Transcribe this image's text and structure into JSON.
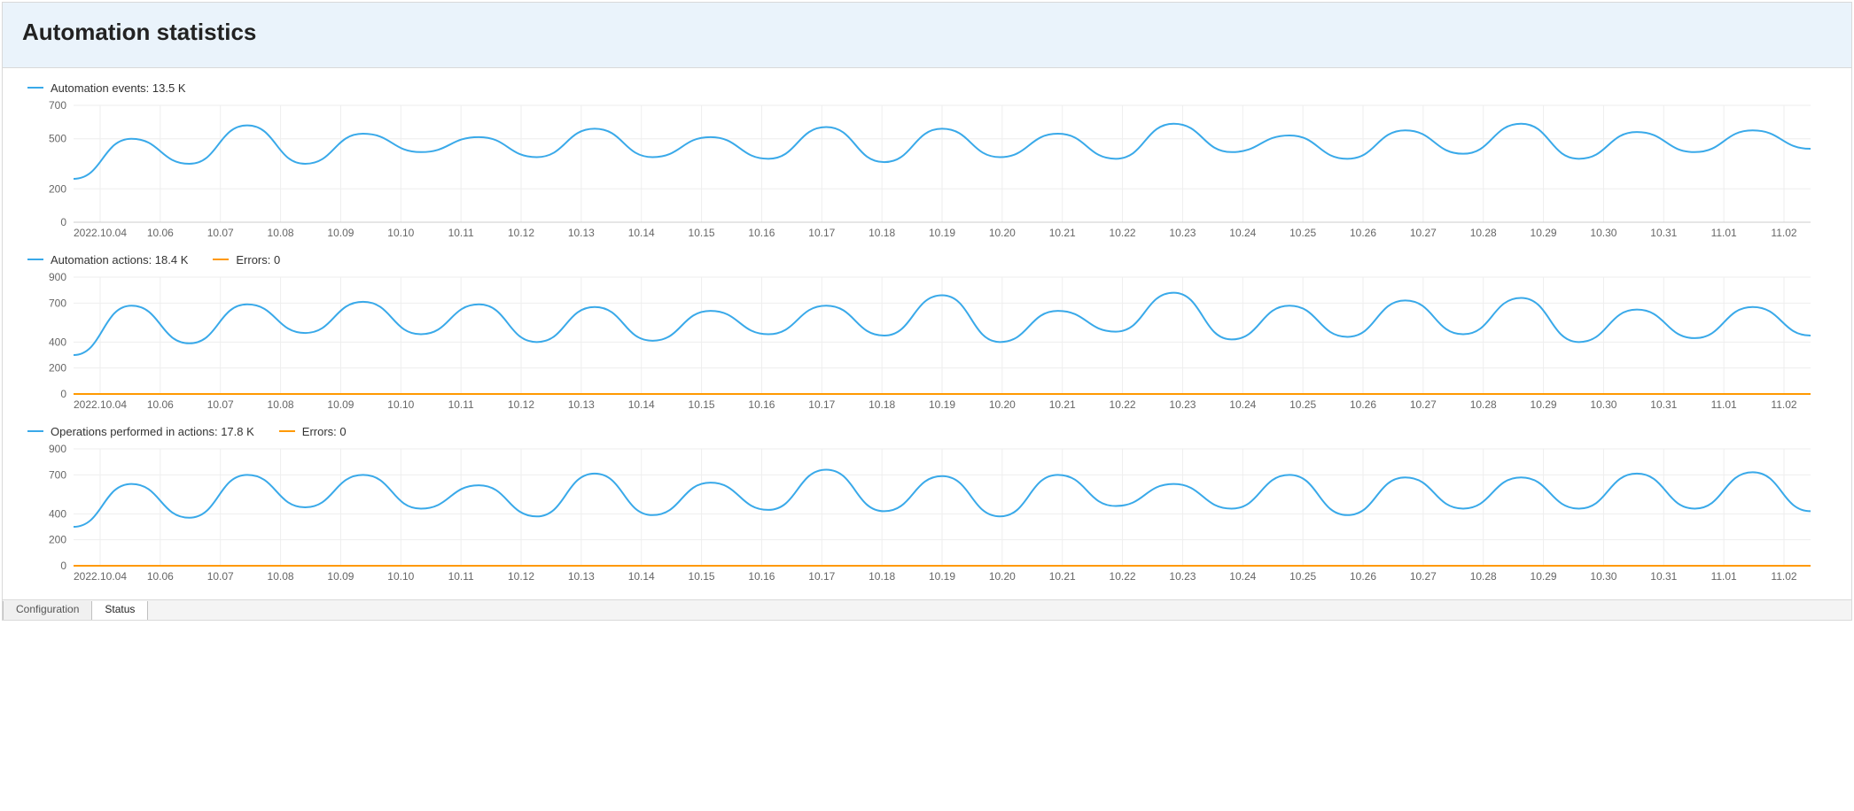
{
  "header": {
    "title": "Automation statistics"
  },
  "colors": {
    "series_blue": "#39a9e9",
    "series_orange": "#ff9900"
  },
  "tabs": {
    "items": [
      {
        "label": "Configuration",
        "active": false
      },
      {
        "label": "Status",
        "active": true
      }
    ]
  },
  "chart_data": [
    {
      "type": "line",
      "title": "",
      "xlabel": "",
      "ylabel": "",
      "ylim": [
        0,
        700
      ],
      "yticks": [
        0,
        200,
        500,
        700
      ],
      "categories": [
        "2022.10.04",
        "10.06",
        "10.07",
        "10.08",
        "10.09",
        "10.10",
        "10.11",
        "10.12",
        "10.13",
        "10.14",
        "10.15",
        "10.16",
        "10.17",
        "10.18",
        "10.19",
        "10.20",
        "10.21",
        "10.22",
        "10.23",
        "10.24",
        "10.25",
        "10.26",
        "10.27",
        "10.28",
        "10.29",
        "10.30",
        "10.31",
        "11.01",
        "11.02"
      ],
      "series": [
        {
          "name": "Automation events",
          "legend_label": "Automation events: 13.5 K",
          "color": "blue",
          "values": [
            260,
            500,
            350,
            580,
            350,
            530,
            420,
            510,
            390,
            560,
            390,
            510,
            380,
            570,
            360,
            560,
            390,
            530,
            380,
            590,
            420,
            520,
            380,
            550,
            410,
            590,
            380,
            540,
            420,
            550,
            440
          ]
        }
      ]
    },
    {
      "type": "line",
      "title": "",
      "xlabel": "",
      "ylabel": "",
      "ylim": [
        0,
        900
      ],
      "yticks": [
        0,
        200,
        400,
        700,
        900
      ],
      "categories": [
        "2022.10.04",
        "10.06",
        "10.07",
        "10.08",
        "10.09",
        "10.10",
        "10.11",
        "10.12",
        "10.13",
        "10.14",
        "10.15",
        "10.16",
        "10.17",
        "10.18",
        "10.19",
        "10.20",
        "10.21",
        "10.22",
        "10.23",
        "10.24",
        "10.25",
        "10.26",
        "10.27",
        "10.28",
        "10.29",
        "10.30",
        "10.31",
        "11.01",
        "11.02"
      ],
      "series": [
        {
          "name": "Automation actions",
          "legend_label": "Automation actions: 18.4 K",
          "color": "blue",
          "values": [
            300,
            680,
            390,
            690,
            470,
            710,
            460,
            690,
            400,
            670,
            410,
            640,
            460,
            680,
            450,
            760,
            400,
            640,
            480,
            780,
            420,
            680,
            440,
            720,
            460,
            740,
            400,
            650,
            430,
            670,
            450
          ]
        },
        {
          "name": "Errors",
          "legend_label": "Errors: 0",
          "color": "orange",
          "values": [
            0,
            0,
            0,
            0,
            0,
            0,
            0,
            0,
            0,
            0,
            0,
            0,
            0,
            0,
            0,
            0,
            0,
            0,
            0,
            0,
            0,
            0,
            0,
            0,
            0,
            0,
            0,
            0,
            0,
            0,
            0
          ]
        }
      ]
    },
    {
      "type": "line",
      "title": "",
      "xlabel": "",
      "ylabel": "",
      "ylim": [
        0,
        900
      ],
      "yticks": [
        0,
        200,
        400,
        700,
        900
      ],
      "categories": [
        "2022.10.04",
        "10.06",
        "10.07",
        "10.08",
        "10.09",
        "10.10",
        "10.11",
        "10.12",
        "10.13",
        "10.14",
        "10.15",
        "10.16",
        "10.17",
        "10.18",
        "10.19",
        "10.20",
        "10.21",
        "10.22",
        "10.23",
        "10.24",
        "10.25",
        "10.26",
        "10.27",
        "10.28",
        "10.29",
        "10.30",
        "10.31",
        "11.01",
        "11.02"
      ],
      "series": [
        {
          "name": "Operations performed in actions",
          "legend_label": "Operations performed in actions: 17.8 K",
          "color": "blue",
          "values": [
            300,
            630,
            370,
            700,
            450,
            700,
            440,
            620,
            380,
            710,
            390,
            640,
            430,
            740,
            420,
            690,
            380,
            700,
            460,
            630,
            440,
            700,
            390,
            680,
            440,
            680,
            440,
            710,
            440,
            720,
            420
          ]
        },
        {
          "name": "Errors",
          "legend_label": "Errors: 0",
          "color": "orange",
          "values": [
            0,
            0,
            0,
            0,
            0,
            0,
            0,
            0,
            0,
            0,
            0,
            0,
            0,
            0,
            0,
            0,
            0,
            0,
            0,
            0,
            0,
            0,
            0,
            0,
            0,
            0,
            0,
            0,
            0,
            0,
            0
          ]
        }
      ]
    }
  ]
}
